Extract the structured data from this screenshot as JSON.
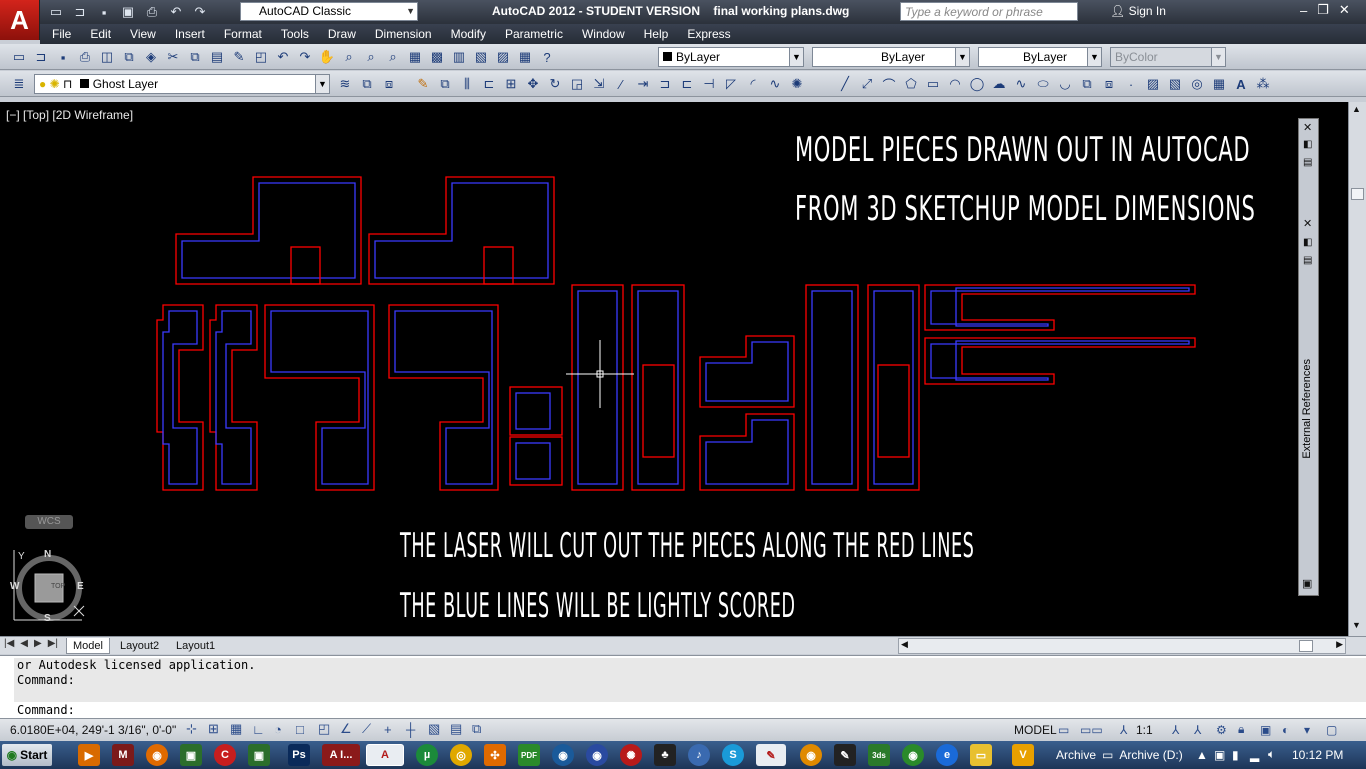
{
  "titlebar": {
    "workspace": "AutoCAD Classic",
    "window_title": "AutoCAD 2012 - STUDENT VERSION    final working plans.dwg",
    "search_placeholder": "Type a keyword or phrase",
    "sign_in": "Sign In"
  },
  "menu": [
    "File",
    "Edit",
    "View",
    "Insert",
    "Format",
    "Tools",
    "Draw",
    "Dimension",
    "Modify",
    "Parametric",
    "Window",
    "Help",
    "Express"
  ],
  "toolbar1": {
    "color": "ByLayer",
    "linetype": "ByLayer",
    "lineweight": "ByLayer",
    "plotstyle": "ByColor"
  },
  "toolbar2": {
    "layer": "Ghost Layer"
  },
  "viewport": {
    "label": "[−] [Top] [2D Wireframe]"
  },
  "annotations": [
    "MODEL PIECES DRAWN OUT IN AUTOCAD",
    "FROM 3D SKETCHUP MODEL DIMENSIONS",
    "THE LASER WILL CUT OUT THE PIECES ALONG THE RED LINES",
    "THE BLUE LINES WILL BE LIGHTLY SCORED"
  ],
  "palette": {
    "title": "External References"
  },
  "viewcube": {
    "top": "TOP",
    "n": "N",
    "s": "S",
    "e": "E",
    "w": "W",
    "wcs": "WCS",
    "y": "Y"
  },
  "tabs": [
    "Model",
    "Layout2",
    "Layout1"
  ],
  "command": {
    "history": [
      "or Autodesk licensed application.",
      "Command:"
    ],
    "prompt": "Command:"
  },
  "status": {
    "coords": "6.0180E+04,  249'-1 3/16\", 0'-0\"",
    "model": "MODEL",
    "scale": "1:1"
  },
  "taskbar": {
    "start": "Start",
    "tray_label": "Archive",
    "tray_drive": "Archive (D:)",
    "clock": "10:12 PM"
  },
  "colors": {
    "cut_line": "#ff0000",
    "score_line": "#3333ff",
    "canvas": "#000000"
  }
}
